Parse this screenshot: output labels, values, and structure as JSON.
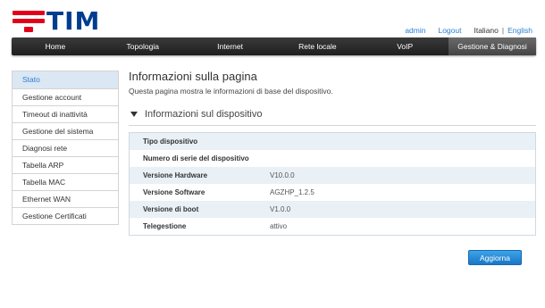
{
  "brand": {
    "name": "TIM",
    "logo_colors": {
      "mark": "#e2001a",
      "text": "#003d8f"
    }
  },
  "toplinks": {
    "user": "admin",
    "logout": "Logout",
    "lang_current": "Italiano",
    "lang_separator": "|",
    "lang_other": "English"
  },
  "nav": {
    "items": [
      {
        "label": "Home"
      },
      {
        "label": "Topologia"
      },
      {
        "label": "Internet"
      },
      {
        "label": "Rete locale"
      },
      {
        "label": "VoIP"
      },
      {
        "label": "Gestione & Diagnosi",
        "active": true
      }
    ]
  },
  "sidebar": {
    "items": [
      {
        "label": "Stato",
        "active": true
      },
      {
        "label": "Gestione account"
      },
      {
        "label": "Timeout di inattività"
      },
      {
        "label": "Gestione del sistema"
      },
      {
        "label": "Diagnosi rete"
      },
      {
        "label": "Tabella ARP"
      },
      {
        "label": "Tabella MAC"
      },
      {
        "label": "Ethernet WAN"
      },
      {
        "label": "Gestione Certificati"
      }
    ]
  },
  "main": {
    "title": "Informazioni sulla pagina",
    "description": "Questa pagina mostra le informazioni di base del dispositivo.",
    "section_title": "Informazioni sul dispositivo",
    "rows": [
      {
        "label": "Tipo dispositivo",
        "value": ""
      },
      {
        "label": "Numero di serie del dispositivo",
        "value": ""
      },
      {
        "label": "Versione Hardware",
        "value": "V10.0.0"
      },
      {
        "label": "Versione Software",
        "value": "AGZHP_1.2.5"
      },
      {
        "label": "Versione di boot",
        "value": "V1.0.0"
      },
      {
        "label": "Telegestione",
        "value": "attivo"
      }
    ],
    "refresh_label": "Aggiorna"
  },
  "colors": {
    "accent": "#2a7fd4",
    "button": "#2a8fd8",
    "navbar": "#2b2b2b",
    "sidebar_active_bg": "#dbe7f3",
    "table_stripe": "#e9f0f6"
  }
}
